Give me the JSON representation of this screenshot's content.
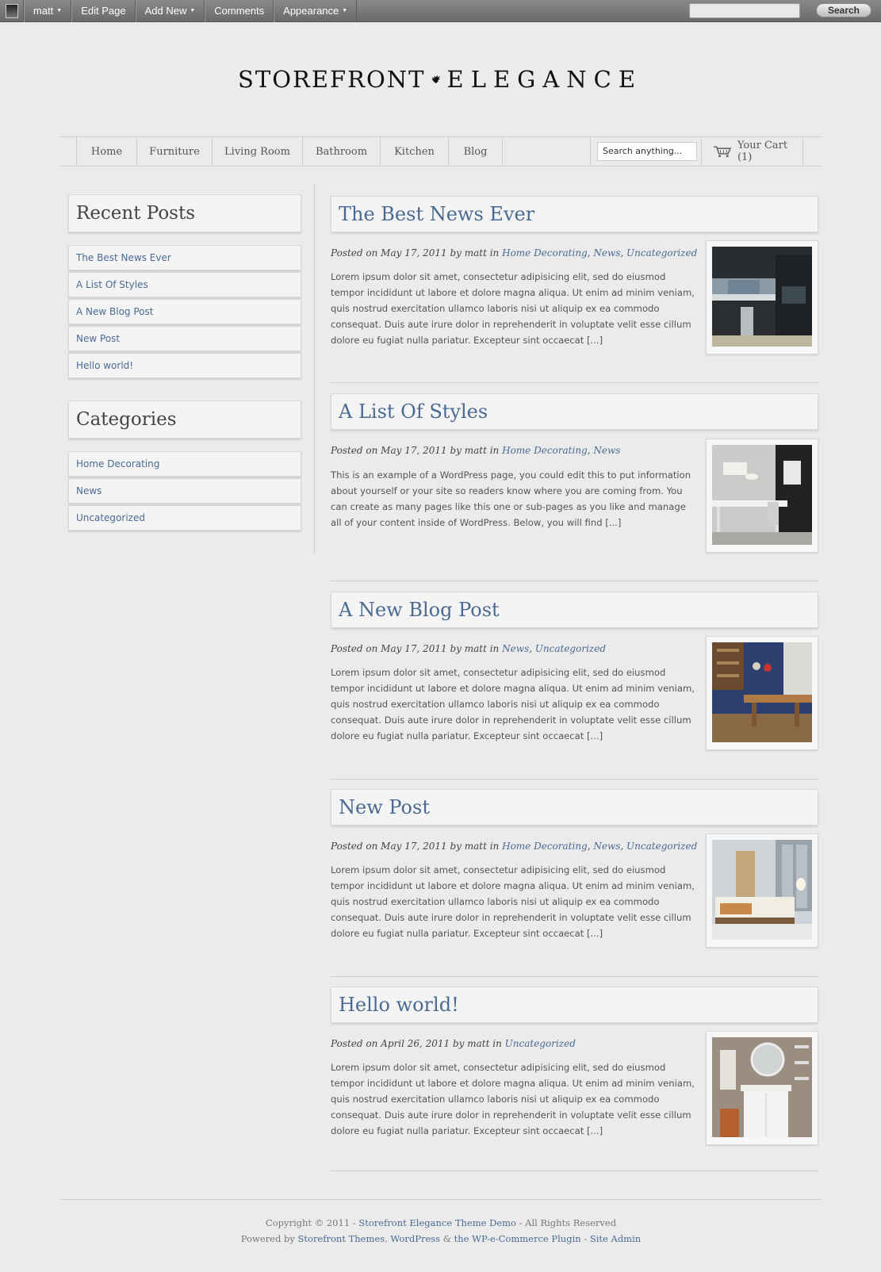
{
  "admin_bar": {
    "user": "matt",
    "items": [
      "Edit Page",
      "Add New",
      "Comments",
      "Appearance"
    ],
    "search_button": "Search"
  },
  "logo": {
    "left": "STOREFRONT",
    "right": "ELEGANCE",
    "mark_icon": "raven-icon"
  },
  "nav": {
    "items": [
      "Home",
      "Furniture",
      "Living Room",
      "Bathroom",
      "Kitchen",
      "Blog"
    ],
    "search_placeholder": "Search anything...",
    "cart_label": "Your Cart (1)",
    "cart_icon": "cart-icon"
  },
  "sidebar": {
    "recent_title": "Recent Posts",
    "recent": [
      "The Best News Ever",
      "A List Of Styles",
      "A New Blog Post",
      "New Post",
      "Hello world!"
    ],
    "categories_title": "Categories",
    "categories": [
      "Home Decorating",
      "News",
      "Uncategorized"
    ]
  },
  "posts": [
    {
      "title": "The Best News Ever",
      "meta_prefix": "Posted on May 17, 2011 by matt in",
      "categories": [
        "Home Decorating",
        "News",
        "Uncategorized"
      ],
      "excerpt": "Lorem ipsum dolor sit amet, consectetur adipisicing elit, sed do eiusmod tempor incididunt ut labore et dolore magna aliqua. Ut enim ad minim veniam, quis nostrud exercitation ullamco laboris nisi ut aliquip ex ea commodo consequat. Duis aute irure dolor in reprehenderit in voluptate velit esse cillum dolore eu fugiat nulla pariatur. Excepteur sint occaecat [...]"
    },
    {
      "title": "A List Of Styles",
      "meta_prefix": "Posted on May 17, 2011 by matt in",
      "categories": [
        "Home Decorating",
        "News"
      ],
      "excerpt": "This is an example of a WordPress page, you could edit this to put information about yourself or your site so readers know where you are coming from. You can create as many pages like this one or sub-pages as you like and manage all of your content inside of WordPress. Below, you will find [...]"
    },
    {
      "title": "A New Blog Post",
      "meta_prefix": "Posted on May 17, 2011 by matt in",
      "categories": [
        "News",
        "Uncategorized"
      ],
      "excerpt": "Lorem ipsum dolor sit amet, consectetur adipisicing elit, sed do eiusmod tempor incididunt ut labore et dolore magna aliqua. Ut enim ad minim veniam, quis nostrud exercitation ullamco laboris nisi ut aliquip ex ea commodo consequat. Duis aute irure dolor in reprehenderit in voluptate velit esse cillum dolore eu fugiat nulla pariatur. Excepteur sint occaecat [...]"
    },
    {
      "title": "New Post",
      "meta_prefix": "Posted on May 17, 2011 by matt in",
      "categories": [
        "Home Decorating",
        "News",
        "Uncategorized"
      ],
      "excerpt": "Lorem ipsum dolor sit amet, consectetur adipisicing elit, sed do eiusmod tempor incididunt ut labore et dolore magna aliqua. Ut enim ad minim veniam, quis nostrud exercitation ullamco laboris nisi ut aliquip ex ea commodo consequat. Duis aute irure dolor in reprehenderit in voluptate velit esse cillum dolore eu fugiat nulla pariatur. Excepteur sint occaecat [...]"
    },
    {
      "title": "Hello world!",
      "meta_prefix": "Posted on April 26, 2011 by matt in",
      "categories": [
        "Uncategorized"
      ],
      "excerpt": "Lorem ipsum dolor sit amet, consectetur adipisicing elit, sed do eiusmod tempor incididunt ut labore et dolore magna aliqua. Ut enim ad minim veniam, quis nostrud exercitation ullamco laboris nisi ut aliquip ex ea commodo consequat. Duis aute irure dolor in reprehenderit in voluptate velit esse cillum dolore eu fugiat nulla pariatur. Excepteur sint occaecat [...]"
    }
  ],
  "footer": {
    "line1_prefix": "Copyright © 2011 -",
    "line1_link": "Storefront Elegance Theme Demo",
    "line1_suffix": "- All Rights Reserved",
    "line2_prefix": "Powered by",
    "line2_link1": "Storefront Themes",
    "line2_sep1": ",",
    "line2_link2": "WordPress",
    "line2_sep2": "&",
    "line2_link3": "the WP-e-Commerce Plugin",
    "line2_sep3": "-",
    "line2_link4": "Site Admin"
  },
  "colors": {
    "link": "#4a6a91",
    "background": "#ebebec",
    "admin_bar": "#777777"
  }
}
